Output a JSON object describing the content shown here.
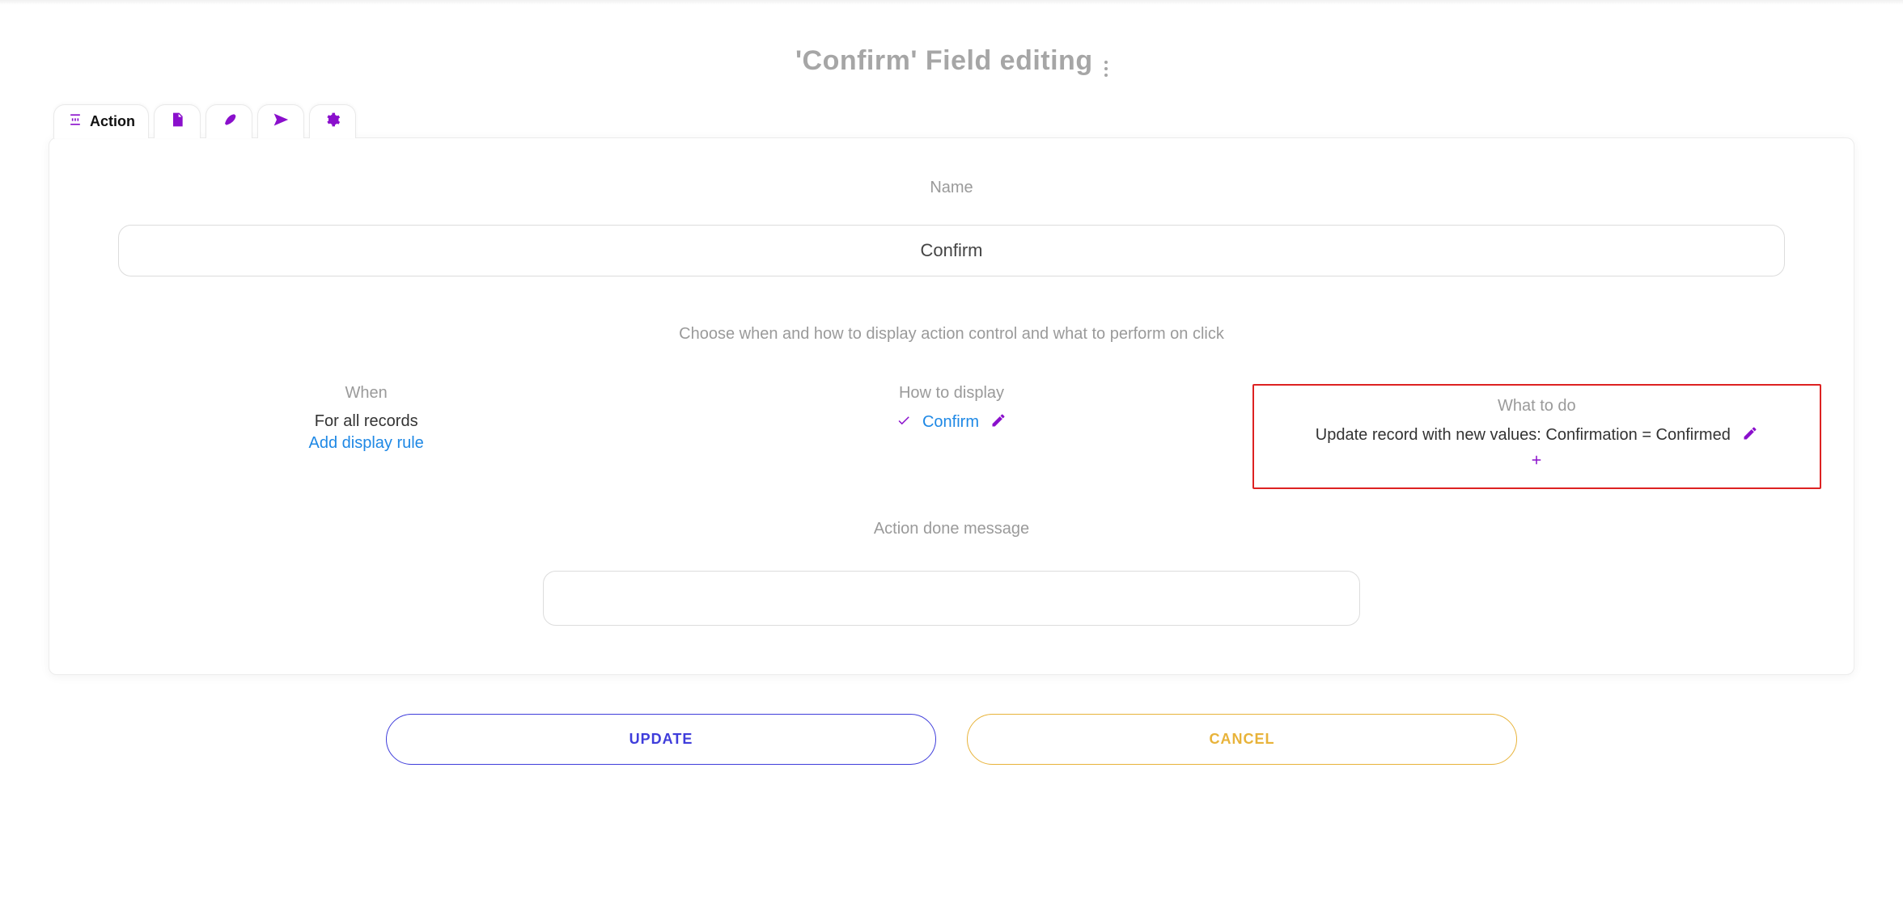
{
  "title": "'Confirm' Field editing",
  "tabs": {
    "action_label": "Action"
  },
  "panel": {
    "name_label": "Name",
    "name_value": "Confirm",
    "subheading": "Choose when and how to display action control and what to perform on click",
    "when": {
      "header": "When",
      "line": "For all records",
      "add_rule_link": "Add display rule"
    },
    "display": {
      "header": "How to display",
      "value": "Confirm"
    },
    "whattodo": {
      "header": "What to do",
      "line": "Update record with new values: Confirmation = Confirmed"
    },
    "action_done_label": "Action done message",
    "action_done_value": ""
  },
  "buttons": {
    "update": "UPDATE",
    "cancel": "CANCEL"
  }
}
